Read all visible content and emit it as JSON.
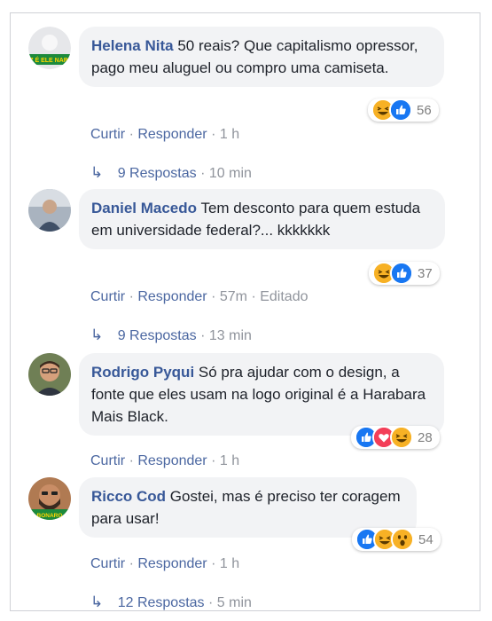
{
  "comments": [
    {
      "author": "Helena Nita",
      "text": "50 reais? Que capitalismo opressor, pago meu aluguel ou compro uma camiseta.",
      "like": "Curtir",
      "reply": "Responder",
      "time": "1 h",
      "reaction_count": "56",
      "reactions": [
        "haha-icon",
        "like-icon"
      ],
      "avatar_badge": "17 É ELE NARO",
      "replies_label": "9 Respostas",
      "replies_time": "10 min"
    },
    {
      "author": "Daniel Macedo",
      "text": "Tem desconto para quem estuda em universidade federal?... kkkkkkk",
      "like": "Curtir",
      "reply": "Responder",
      "time": "57m",
      "edited": "Editado",
      "reaction_count": "37",
      "reactions": [
        "haha-icon",
        "like-icon"
      ],
      "replies_label": "9 Respostas",
      "replies_time": "13 min"
    },
    {
      "author": "Rodrigo Pyqui",
      "text": "Só pra ajudar com o design, a fonte que eles usam na logo original é a Harabara Mais Black.",
      "like": "Curtir",
      "reply": "Responder",
      "time": "1 h",
      "reaction_count": "28",
      "reactions": [
        "like-icon",
        "love-icon",
        "haha-icon"
      ]
    },
    {
      "author": "Ricco Cod",
      "text": "Gostei, mas é preciso ter coragem para usar!",
      "like": "Curtir",
      "reply": "Responder",
      "time": "1 h",
      "reaction_count": "54",
      "reactions": [
        "like-icon",
        "haha-icon",
        "wow-icon"
      ],
      "avatar_badge": "BONARO",
      "replies_label": "12 Respostas",
      "replies_time": "5 min"
    }
  ],
  "separator": "·",
  "colors": {
    "name": "#385898",
    "link": "#4b67a1",
    "meta": "#90949c",
    "bubble": "#f2f3f5",
    "like": "#1877f2",
    "love": "#f33e58",
    "haha": "#f7b125"
  }
}
